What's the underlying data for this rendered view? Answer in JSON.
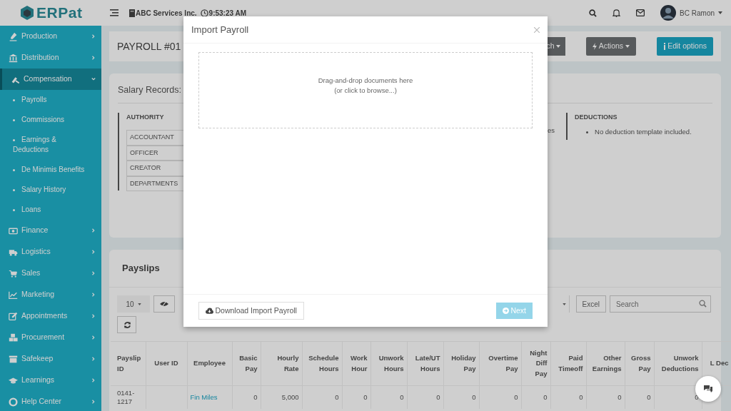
{
  "app": {
    "logo": "ERPat"
  },
  "topbar": {
    "company": "ABC Services Inc.",
    "time": "9:53:23 AM",
    "user": "BC Ramon"
  },
  "sidebar": {
    "items": [
      {
        "label": "Production",
        "expanded": false
      },
      {
        "label": "Distribution",
        "expanded": false
      },
      {
        "label": "Compensation",
        "expanded": true,
        "children": [
          {
            "label": "Payrolls"
          },
          {
            "label": "Commissions"
          },
          {
            "label": "Earnings & Deductions"
          },
          {
            "label": "De Minimis Benefits"
          },
          {
            "label": "Salary History"
          },
          {
            "label": "Loans"
          }
        ]
      },
      {
        "label": "Finance",
        "expanded": false
      },
      {
        "label": "Logistics",
        "expanded": false
      },
      {
        "label": "Sales",
        "expanded": false
      },
      {
        "label": "Marketing",
        "expanded": false
      },
      {
        "label": "Appointments",
        "expanded": false
      },
      {
        "label": "Procurement",
        "expanded": false
      },
      {
        "label": "Safekeep",
        "expanded": false
      },
      {
        "label": "Learnings",
        "expanded": false
      },
      {
        "label": "Help Center",
        "expanded": false
      }
    ]
  },
  "page_header": {
    "title": "PAYROLL #01",
    "buttons": [
      {
        "label": "ch",
        "kind": "dark"
      },
      {
        "label": "Actions",
        "kind": "dark"
      },
      {
        "label": "Edit options",
        "kind": "info"
      }
    ]
  },
  "salary_records": {
    "title": "Salary Records:",
    "authority": {
      "heading": "AUTHORITY",
      "rows": [
        "ACCOUNTANT",
        "OFFICER",
        "CREATOR",
        "DEPARTMENTS"
      ]
    },
    "fragment": "es",
    "deductions": {
      "heading": "DEDUCTIONS",
      "items": [
        "No deduction template included."
      ]
    }
  },
  "payslips": {
    "title": "Payslips",
    "page_length": "10",
    "excel": "Excel",
    "search": {
      "placeholder": "Search"
    },
    "table": {
      "columns": [
        "Payslip ID",
        "User ID",
        "Employee",
        "Basic Pay",
        "Hourly Rate",
        "Schedule Hours",
        "Work Hour",
        "Unwork Hours",
        "Late/UT Hours",
        "Holiday Pay",
        "Overtime Pay",
        "Night Diff Pay",
        "Paid Timeoff",
        "Other Earnings",
        "Gross Pay",
        "Unwork Deductions",
        "L Dec"
      ],
      "rows": [
        {
          "cells": [
            {
              "kind": "text",
              "text": "0141-1217"
            },
            {
              "kind": "blank"
            },
            {
              "kind": "link",
              "text": "Fin Miles"
            },
            {
              "kind": "num",
              "text": "0"
            },
            {
              "kind": "num",
              "text": "5,000"
            },
            {
              "kind": "num",
              "text": "0"
            },
            {
              "kind": "num",
              "text": "0"
            },
            {
              "kind": "num",
              "text": "0"
            },
            {
              "kind": "num",
              "text": "0"
            },
            {
              "kind": "num",
              "text": "0"
            },
            {
              "kind": "num",
              "text": "0"
            },
            {
              "kind": "num",
              "text": "0"
            },
            {
              "kind": "num",
              "text": "0"
            },
            {
              "kind": "num",
              "text": "0"
            },
            {
              "kind": "num",
              "text": "0"
            },
            {
              "kind": "num",
              "text": "0"
            },
            {
              "kind": "blank"
            }
          ]
        }
      ]
    }
  },
  "modal": {
    "title": "Import Payroll",
    "dropzone": "Drag-and-drop documents here\n(or click to browse...)",
    "download": "Download Import Payroll",
    "next": {
      "label": "Next",
      "disabled": true
    }
  }
}
